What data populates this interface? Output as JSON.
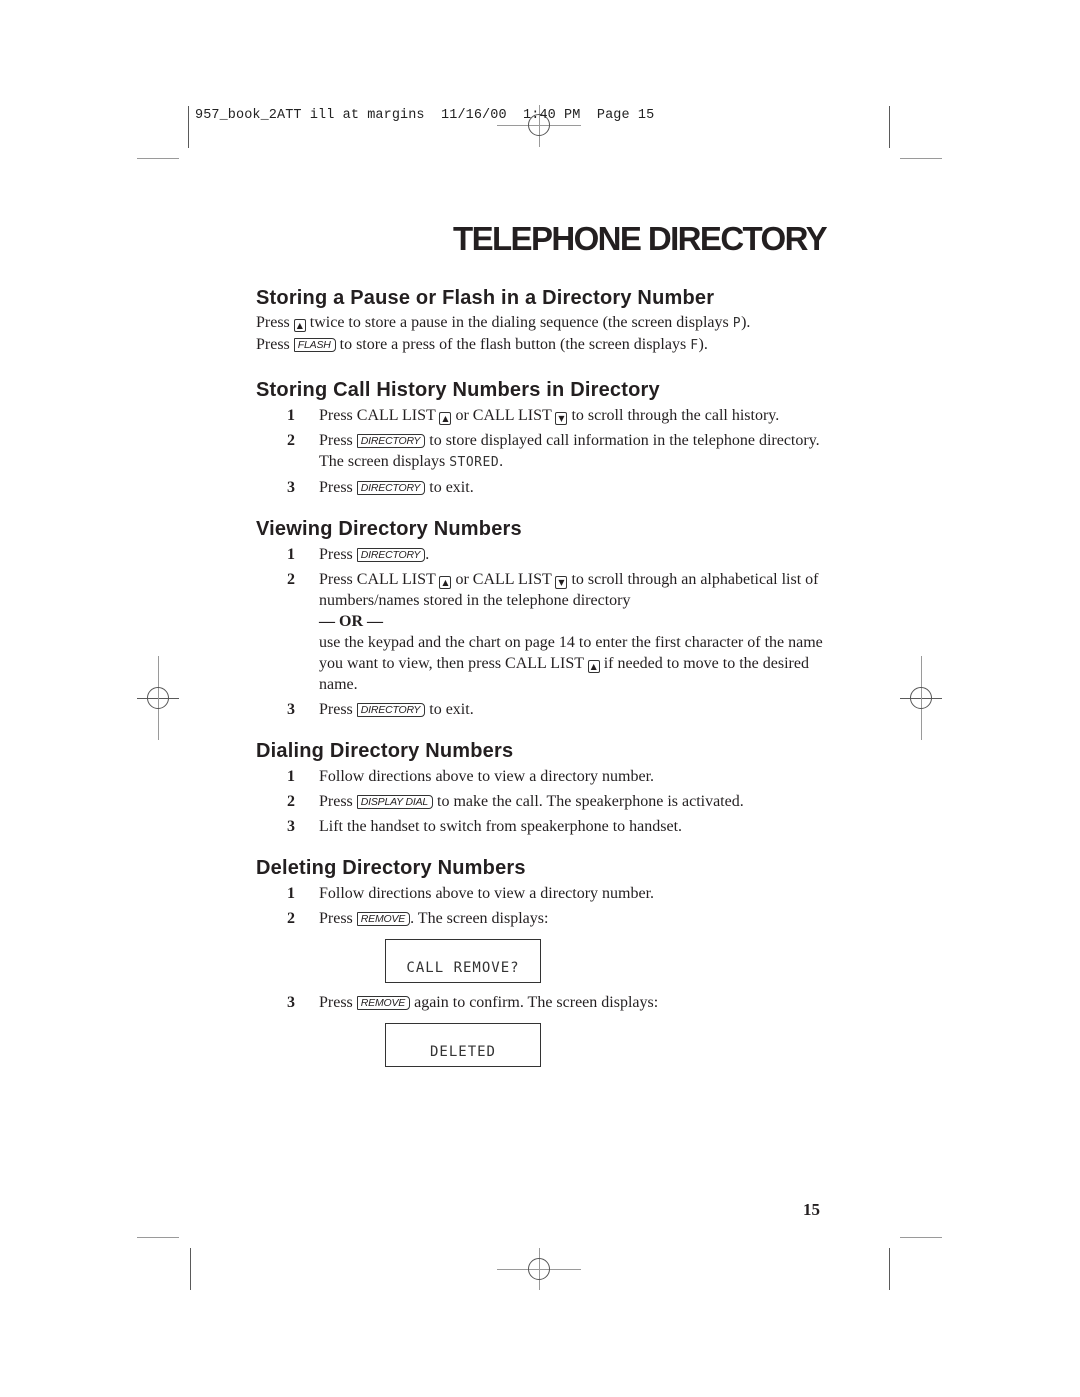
{
  "slug": "957_book_2ATT ill at margins  11/16/00  1:40 PM  Page 15",
  "page_title": "TELEPHONE DIRECTORY",
  "page_number": "15",
  "icons": {
    "up_arrow": "▲",
    "down_arrow": "▼"
  },
  "sections": {
    "pause_flash": {
      "heading": "Storing a Pause or Flash in a Directory Number",
      "line1": {
        "pre": "Press",
        "post": "twice to store a pause in the dialing sequence (the screen displays",
        "display": "P",
        "end": ")."
      },
      "line2": {
        "pre": "Press",
        "key": "FLASH",
        "post": "to store a press of the flash button (the screen displays",
        "display": "F",
        "end": ")."
      }
    },
    "call_history": {
      "heading": "Storing Call History Numbers in Directory",
      "steps": [
        {
          "num": "1",
          "a": "Press CALL LIST",
          "b": "or CALL LIST",
          "c": "to scroll through the call history."
        },
        {
          "num": "2",
          "a": "Press",
          "key": "DIRECTORY",
          "b": "to store displayed call information in the telephone directory. The screen displays",
          "display": "STORED",
          "c": "."
        },
        {
          "num": "3",
          "a": "Press",
          "key": "DIRECTORY",
          "b": "to exit."
        }
      ]
    },
    "viewing": {
      "heading": "Viewing Directory Numbers",
      "steps": [
        {
          "num": "1",
          "a": "Press",
          "key": "DIRECTORY",
          "b": "."
        },
        {
          "num": "2",
          "a": "Press CALL LIST",
          "b": "or CALL LIST",
          "c": "to scroll through an alphabetical list of numbers/names stored in the telephone directory",
          "or": "— OR —",
          "d": "use the keypad and the chart on page 14 to enter the first character of the name you want to view, then press CALL LIST",
          "e": "if needed to move to the desired name."
        },
        {
          "num": "3",
          "a": "Press",
          "key": "DIRECTORY",
          "b": "to exit."
        }
      ]
    },
    "dialing": {
      "heading": "Dialing Directory Numbers",
      "steps": [
        {
          "num": "1",
          "a": "Follow directions above to view a directory number."
        },
        {
          "num": "2",
          "a": "Press",
          "key": "DISPLAY DIAL",
          "b": "to make the call. The speakerphone is activated."
        },
        {
          "num": "3",
          "a": "Lift the handset to switch from speakerphone to handset."
        }
      ]
    },
    "deleting": {
      "heading": "Deleting Directory Numbers",
      "steps": [
        {
          "num": "1",
          "a": "Follow directions above to view a directory number."
        },
        {
          "num": "2",
          "a": "Press",
          "key": "REMOVE",
          "b": ". The screen displays:",
          "screen": "CALL REMOVE?"
        },
        {
          "num": "3",
          "a": "Press",
          "key": "REMOVE",
          "b": "again to confirm. The screen displays:",
          "screen": "DELETED"
        }
      ]
    }
  }
}
